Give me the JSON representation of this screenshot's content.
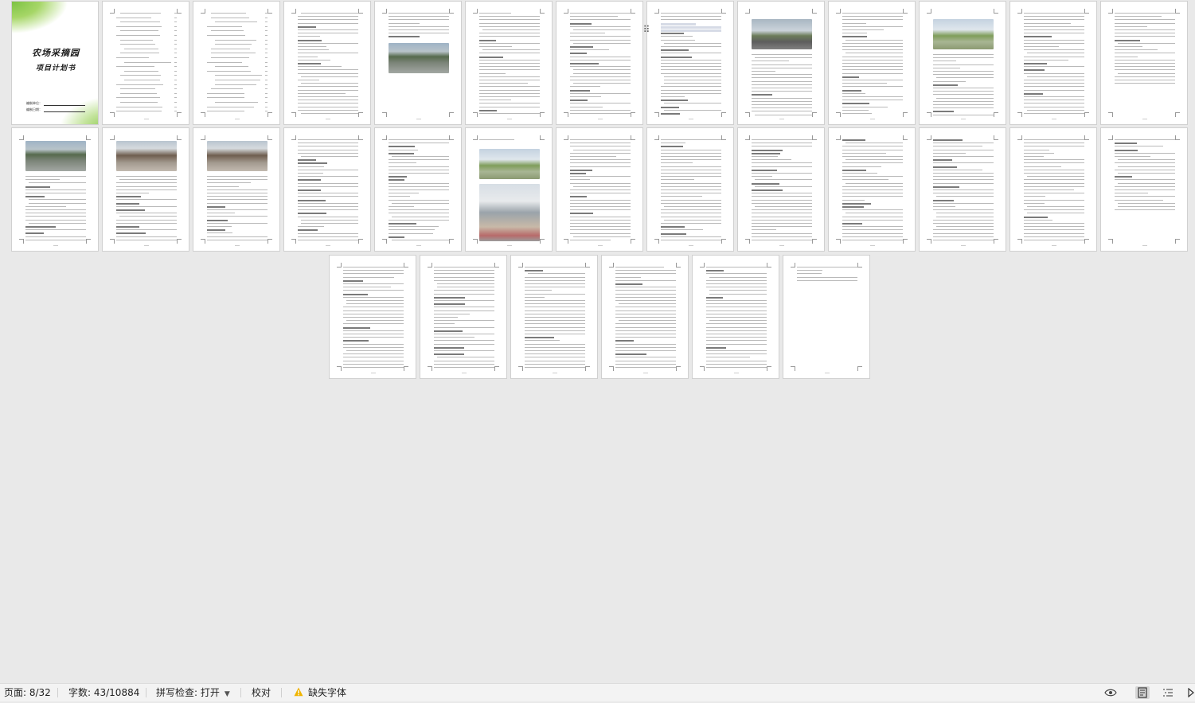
{
  "document": {
    "cover_title_line1": "农场采摘园",
    "cover_title_line2": "项目计划书",
    "cover_field1": "编制单位：",
    "cover_field2": "编制日期："
  },
  "status_bar": {
    "page": "页面: 8/32",
    "word_count": "字数: 43/10884",
    "spell_check": "拼写检查: 打开",
    "proofread": "校对",
    "missing_font": "缺失字体"
  },
  "icons": {
    "warning": "warning-icon",
    "read_mode": "eye-icon",
    "page_view": "page-view-icon",
    "outline_view": "outline-icon",
    "web_view": "play-icon"
  },
  "colors": {
    "background": "#e9e9e9",
    "page": "#ffffff",
    "cover_green": "#7cc243",
    "warning": "#f0b400"
  }
}
